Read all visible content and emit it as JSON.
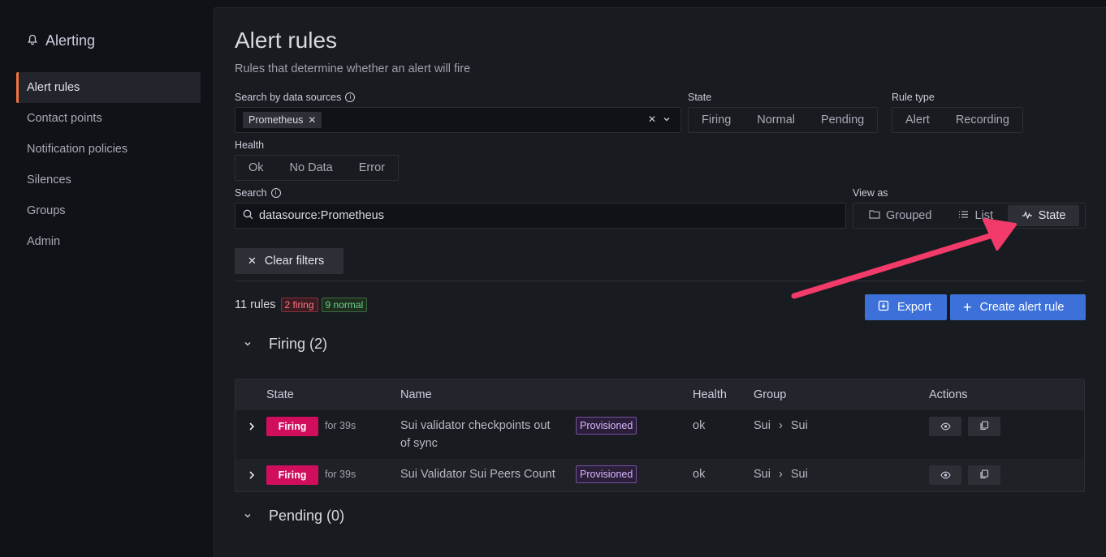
{
  "sidebar": {
    "title": "Alerting",
    "items": [
      {
        "label": "Alert rules",
        "active": true
      },
      {
        "label": "Contact points"
      },
      {
        "label": "Notification policies"
      },
      {
        "label": "Silences"
      },
      {
        "label": "Groups"
      },
      {
        "label": "Admin"
      }
    ]
  },
  "page": {
    "title": "Alert rules",
    "subtitle": "Rules that determine whether an alert will fire"
  },
  "filters": {
    "datasource_label": "Search by data sources",
    "datasource_chip": "Prometheus",
    "state_label": "State",
    "state_options": [
      "Firing",
      "Normal",
      "Pending"
    ],
    "rule_type_label": "Rule type",
    "rule_type_options": [
      "Alert",
      "Recording"
    ],
    "health_label": "Health",
    "health_options": [
      "Ok",
      "No Data",
      "Error"
    ],
    "search_label": "Search",
    "search_value": "datasource:Prometheus",
    "view_as_label": "View as",
    "view_options": [
      "Grouped",
      "List",
      "State"
    ],
    "view_selected": "State",
    "clear_filters": "Clear filters"
  },
  "summary": {
    "count": "11 rules",
    "firing_badge": "2 firing",
    "normal_badge": "9 normal"
  },
  "actions": {
    "export": "Export",
    "create": "Create alert rule"
  },
  "sections": {
    "firing": "Firing (2)",
    "pending": "Pending (0)"
  },
  "table": {
    "headers": [
      "State",
      "Name",
      "Health",
      "Group",
      "Actions"
    ],
    "rows": [
      {
        "state": "Firing",
        "for": "for 39s",
        "name_line1": "Sui validator checkpoints out",
        "name_line2": "of sync",
        "tag": "Provisioned",
        "health": "ok",
        "group": "Sui",
        "subgroup": "Sui"
      },
      {
        "state": "Firing",
        "for": "for 39s",
        "name_line1": "Sui Validator Sui Peers Count",
        "name_line2": "",
        "tag": "Provisioned",
        "health": "ok",
        "group": "Sui",
        "subgroup": "Sui"
      }
    ]
  },
  "colors": {
    "accent": "#f2743d",
    "primary": "#3d71d9",
    "firing": "#d10e5c",
    "annotation_arrow": "#f23b6a"
  }
}
